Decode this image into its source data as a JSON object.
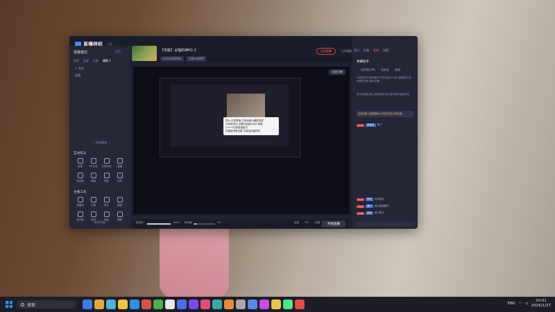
{
  "app": {
    "brand": "直播伴侣",
    "brand_sub": "抖音",
    "room_title": "【专属】合唱的神PG 2",
    "room_tags": [
      "在线合唱直播间",
      "主播合唱推荐"
    ],
    "top_actions": [
      "已开通礼",
      "设置",
      "更多"
    ],
    "pill_label": "正在直播"
  },
  "sidebar": {
    "header": "场景模式",
    "tabs": [
      "常规",
      "竖屏",
      "分屏",
      "横屏 1"
    ],
    "list": [
      "+ 添加",
      "直播"
    ],
    "add_scene": "+ 添加素材",
    "section_live": "互动玩法",
    "live_tools": [
      "连麦",
      "PK对战",
      "礼物特效",
      "直播",
      "粉丝团",
      "福袋",
      "抽奖",
      "任务"
    ],
    "section_tools": "主播工具",
    "tools": [
      "直播间",
      "主题",
      "音乐",
      "美颜",
      "画中画",
      "特效",
      "商品",
      "弹幕"
    ],
    "more": "更多功能"
  },
  "preview": {
    "badge": "全屏切换",
    "tooltip": [
      "提示:分屏直播,左侧画面为横屏竖屏",
      "分辨率提示,设置好画面可自行调整",
      "Ctrl+F切换直播窗口",
      "快捷键请看设置,可直接快捷修改"
    ]
  },
  "controls": {
    "mic_label": "麦克风",
    "mic_value": "100%",
    "speaker_label": "扬声器",
    "speaker_value": "0%",
    "actions": [
      "连麦",
      "PK",
      "设置"
    ],
    "start": "开始直播"
  },
  "chat": {
    "tabs": [
      "观众",
      "礼物",
      "贵宾",
      "设置"
    ],
    "title": "弹幕助手",
    "subtabs": [
      "在线观众PK",
      "活动宝",
      "贴图"
    ],
    "intro": "欢迎来到抖音直播间,严禁未成年人进行直播或打赏,请理性消费,谨防诈骗。",
    "notice": "请文明直播,禁止传播低俗内容,维护良好直播环境。",
    "highlight": "[欢迎]新人进直播间,点击关注加入粉丝团",
    "messages": [
      {
        "badge": "Lv.3",
        "name": "新朋友",
        "text": "来了"
      },
      {
        "badge": "Lv.5",
        "name": "粉丝",
        "text": "可以加入"
      },
      {
        "badge": "Lv.2",
        "name": "路人",
        "text": "加入粉丝团了"
      },
      {
        "badge": "Lv.8",
        "name": "老粉",
        "text": "来了来了"
      }
    ]
  },
  "taskbar": {
    "search_placeholder": "搜索",
    "time": "20:01",
    "date": "2026/1/27",
    "lang": "ENG",
    "icon_colors": [
      "#3a7ee8",
      "#e8a73a",
      "#4ab3d8",
      "#f0c341",
      "#2e8fe8",
      "#d8524a",
      "#46b04a",
      "#e8e8e8",
      "#4a6ee8",
      "#7a4ae8",
      "#e84a7a",
      "#38a8a8",
      "#e88a3a",
      "#a8a8a8",
      "#5a8ae8",
      "#c84ae8",
      "#e8c84a",
      "#4ae88a",
      "#e84a4a"
    ]
  }
}
